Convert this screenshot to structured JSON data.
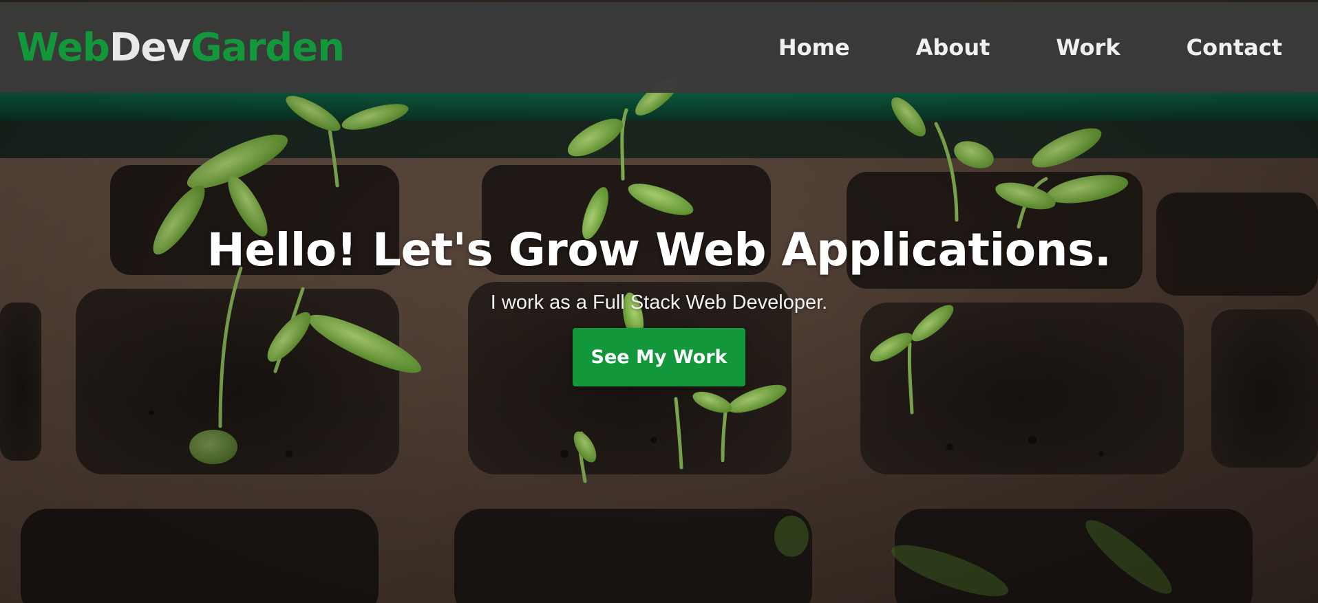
{
  "brand": {
    "part1": "Web",
    "part2": "Dev",
    "part3": "Garden"
  },
  "nav": [
    {
      "label": "Home"
    },
    {
      "label": "About"
    },
    {
      "label": "Work"
    },
    {
      "label": "Contact"
    }
  ],
  "hero": {
    "title": "Hello! Let's Grow Web Applications.",
    "subtitle": "I work as a Full Stack Web Developer.",
    "cta_label": "See My Work"
  },
  "colors": {
    "accent": "#12983a",
    "navbar": "#3a3a3a",
    "text_light": "#ffffff"
  }
}
